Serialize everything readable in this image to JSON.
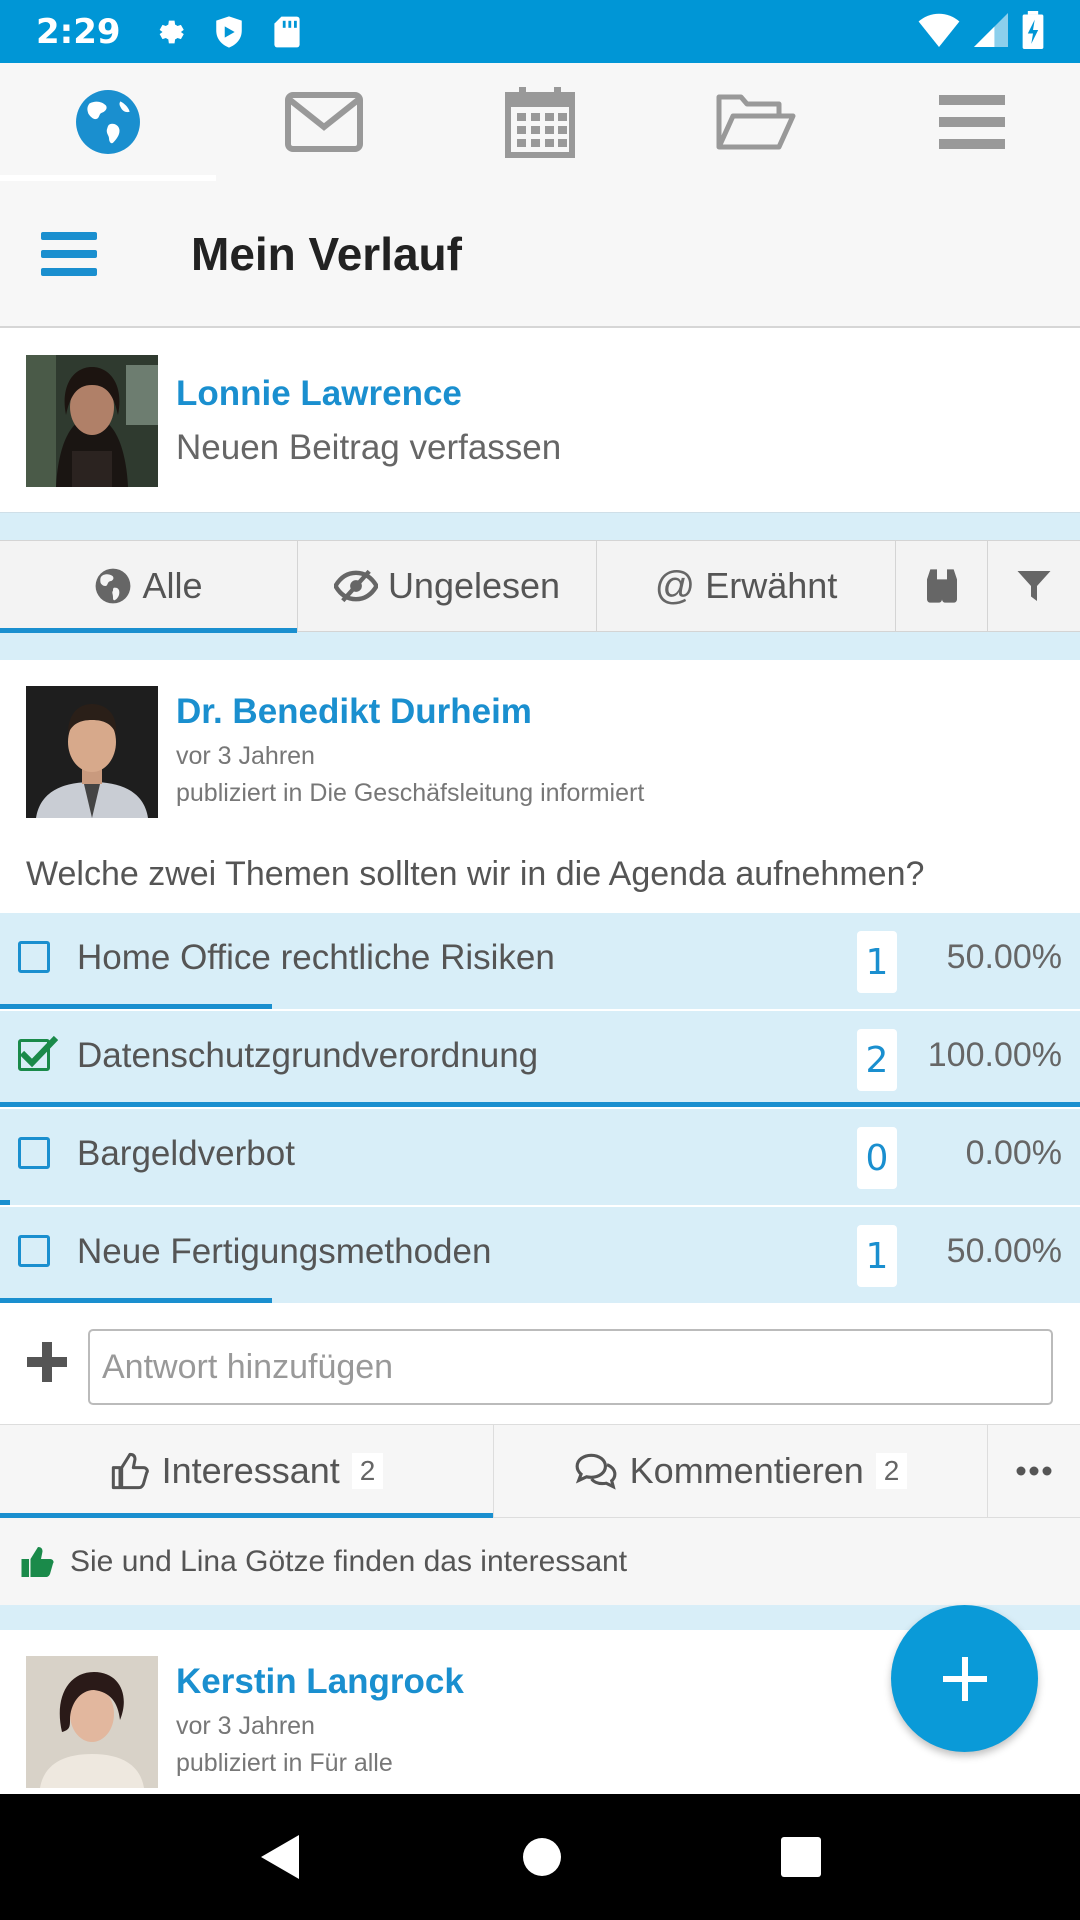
{
  "status_bar": {
    "time": "2:29"
  },
  "top_nav": {
    "items": [
      "globe-icon",
      "envelope-icon",
      "calendar-icon",
      "folder-open-icon",
      "hamburger-menu-icon"
    ],
    "active_index": 0
  },
  "header": {
    "title": "Mein Verlauf"
  },
  "composer": {
    "user_name": "Lonnie Lawrence",
    "prompt": "Neuen Beitrag verfassen"
  },
  "filters": {
    "tabs": [
      {
        "label": "Alle",
        "icon": "globe-icon",
        "active": true
      },
      {
        "label": "Ungelesen",
        "icon": "eye-slash-icon"
      },
      {
        "label": "Erwähnt",
        "icon": "at-icon"
      }
    ],
    "extra_icons": [
      "binoculars-icon",
      "filter-icon"
    ]
  },
  "post": {
    "author": "Dr. Benedikt Durheim",
    "time": "vor 3 Jahren",
    "published_in": "publiziert in Die Geschäfsleitung informiert",
    "question": "Welche zwei Themen sollten wir in die Agenda aufnehmen?",
    "poll": [
      {
        "label": "Home Office rechtliche Risiken",
        "count": "1",
        "percent": "50.00%",
        "checked": false,
        "fraction": 0.5
      },
      {
        "label": "Datenschutzgrundverordnung",
        "count": "2",
        "percent": "100.00%",
        "checked": true,
        "fraction": 1.0
      },
      {
        "label": "Bargeldverbot",
        "count": "0",
        "percent": "0.00%",
        "checked": false,
        "fraction": 0.0
      },
      {
        "label": "Neue Fertigungsmethoden",
        "count": "1",
        "percent": "50.00%",
        "checked": false,
        "fraction": 0.5
      }
    ],
    "answer_placeholder": "Antwort hinzufügen",
    "actions": {
      "like_label": "Interessant",
      "like_count": "2",
      "comment_label": "Kommentieren",
      "comment_count": "2"
    },
    "likes_text": "Sie und Lina Götze finden das interessant"
  },
  "post2": {
    "author": "Kerstin Langrock",
    "time": "vor 3 Jahren",
    "published_in": "publiziert in Für alle"
  },
  "colors": {
    "accent": "#1a8fcf",
    "status_bar": "#0096d6",
    "poll_bg": "#d8eef8",
    "check_green": "#1a8a4a"
  }
}
